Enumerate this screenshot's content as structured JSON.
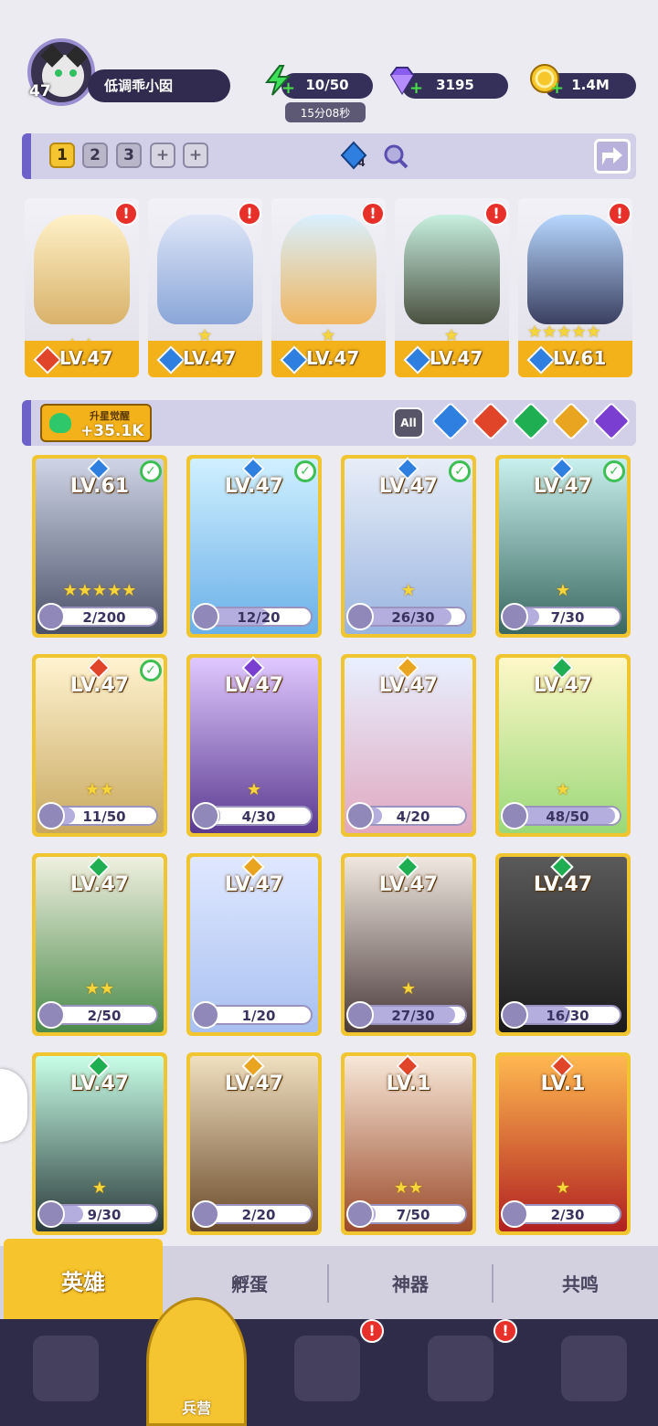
{
  "player": {
    "level": "47",
    "name": "低调乖小囡"
  },
  "resources": [
    {
      "name": "energy",
      "icon": "lightning-icon",
      "value": "10/50"
    },
    {
      "name": "gems",
      "icon": "diamond-icon",
      "value": "3195"
    },
    {
      "name": "gold",
      "icon": "coin-icon",
      "value": "1.4M"
    }
  ],
  "timer": "15分08秒",
  "team": {
    "slots": [
      "1",
      "2",
      "3"
    ],
    "add_labels": [
      "+",
      "+"
    ],
    "crystal_count": "4"
  },
  "team_heroes": [
    {
      "level": "LV.47",
      "element": "fire",
      "stars": 2,
      "alert": "!"
    },
    {
      "level": "LV.47",
      "element": "water",
      "stars": 1,
      "alert": "!"
    },
    {
      "level": "LV.47",
      "element": "water",
      "stars": 1,
      "alert": "!"
    },
    {
      "level": "LV.47",
      "element": "water",
      "stars": 1,
      "alert": "!"
    },
    {
      "level": "LV.61",
      "element": "water",
      "stars": 5,
      "alert": "!"
    }
  ],
  "awaken": {
    "label": "升星觉醒",
    "value": "+35.1K"
  },
  "filters": {
    "all_label": "All",
    "elements": [
      "water",
      "fire",
      "wind",
      "light",
      "dark"
    ]
  },
  "heroes": [
    {
      "level": "LV.61",
      "element": "water",
      "check": true,
      "stars": 5,
      "progress": "2/200",
      "fraction": 0.01
    },
    {
      "level": "LV.47",
      "element": "water",
      "check": true,
      "stars": 0,
      "progress": "12/20",
      "fraction": 0.6
    },
    {
      "level": "LV.47",
      "element": "water",
      "check": true,
      "stars": 1,
      "progress": "26/30",
      "fraction": 0.87
    },
    {
      "level": "LV.47",
      "element": "water",
      "check": true,
      "stars": 1,
      "progress": "7/30",
      "fraction": 0.23
    },
    {
      "level": "LV.47",
      "element": "fire",
      "check": true,
      "stars": 2,
      "progress": "11/50",
      "fraction": 0.22
    },
    {
      "level": "LV.47",
      "element": "dark",
      "check": false,
      "stars": 1,
      "progress": "4/30",
      "fraction": 0.13
    },
    {
      "level": "LV.47",
      "element": "light",
      "check": false,
      "stars": 0,
      "progress": "4/20",
      "fraction": 0.2
    },
    {
      "level": "LV.47",
      "element": "wind",
      "check": false,
      "stars": 1,
      "progress": "48/50",
      "fraction": 0.96
    },
    {
      "level": "LV.47",
      "element": "wind",
      "check": false,
      "stars": 2,
      "progress": "2/50",
      "fraction": 0.04
    },
    {
      "level": "LV.47",
      "element": "light",
      "check": false,
      "stars": 0,
      "progress": "1/20",
      "fraction": 0.05
    },
    {
      "level": "LV.47",
      "element": "wind",
      "check": false,
      "stars": 1,
      "progress": "27/30",
      "fraction": 0.9
    },
    {
      "level": "LV.47",
      "element": "wind",
      "check": false,
      "stars": 0,
      "progress": "16/30",
      "fraction": 0.53
    },
    {
      "level": "LV.47",
      "element": "wind",
      "check": false,
      "stars": 1,
      "progress": "9/30",
      "fraction": 0.3
    },
    {
      "level": "LV.47",
      "element": "light",
      "check": false,
      "stars": 0,
      "progress": "2/20",
      "fraction": 0.1
    },
    {
      "level": "LV.1",
      "element": "fire",
      "check": false,
      "stars": 2,
      "progress": "7/50",
      "fraction": 0.14
    },
    {
      "level": "LV.1",
      "element": "fire",
      "check": false,
      "stars": 1,
      "progress": "2/30",
      "fraction": 0.07
    }
  ],
  "tabs": [
    "英雄",
    "孵蛋",
    "神器",
    "共鸣"
  ],
  "nav": {
    "active_label": "兵营",
    "items": [
      "cards-icon",
      "barracks-icon",
      "map-icon",
      "castle-icon",
      "mushroom-icon"
    ],
    "alert": "!"
  },
  "colors": {
    "water": "#2f7fe0",
    "fire": "#e0452a",
    "wind": "#1fae52",
    "light": "#eaa520",
    "dark": "#7a3ed0",
    "accent": "#f4c431"
  }
}
